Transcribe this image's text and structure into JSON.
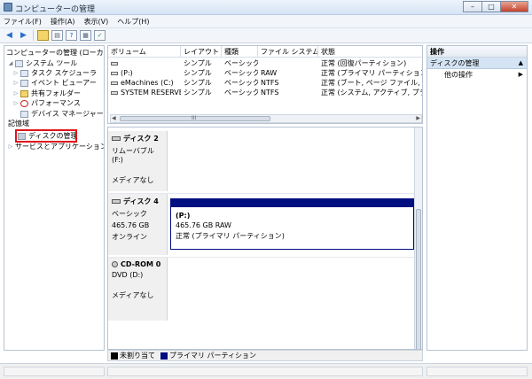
{
  "window": {
    "title": "コンピューターの管理",
    "buttons": [
      "–",
      "□",
      "✕"
    ]
  },
  "menubar": [
    "ファイル(F)",
    "操作(A)",
    "表示(V)",
    "ヘルプ(H)"
  ],
  "toolbar": [
    "back-arrow-icon",
    "forward-arrow-icon",
    "folder-icon",
    "view-icon",
    "help-icon",
    "console-icon",
    "properties-icon"
  ],
  "tree": {
    "root": "コンピューターの管理 (ローカル)",
    "items": [
      {
        "label": "システム ツール",
        "icon": "tools-icon"
      },
      {
        "label": "タスク スケジューラ",
        "icon": "clock-icon"
      },
      {
        "label": "イベント ビューアー",
        "icon": "event-viewer-icon"
      },
      {
        "label": "共有フォルダー",
        "icon": "shared-folder-icon"
      },
      {
        "label": "パフォーマンス",
        "icon": "performance-icon"
      },
      {
        "label": "デバイス マネージャー",
        "icon": "device-manager-icon"
      },
      {
        "label": "記憶域",
        "icon": "storage-icon"
      },
      {
        "label": "ディスクの管理",
        "icon": "disk-icon"
      },
      {
        "label": "サービスとアプリケーション",
        "icon": "services-icon"
      }
    ]
  },
  "volumes": {
    "columns": [
      "ボリューム",
      "レイアウト",
      "種類",
      "ファイル システム",
      "状態"
    ],
    "rows": [
      [
        "",
        "シンプル",
        "ベーシック",
        "",
        "正常 (回復パーティション)"
      ],
      [
        "(P:)",
        "シンプル",
        "ベーシック",
        "RAW",
        "正常 (プライマリ パーティション)"
      ],
      [
        "eMachines (C:)",
        "シンプル",
        "ベーシック",
        "NTFS",
        "正常 (ブート, ページ ファイル, クラ"
      ],
      [
        "SYSTEM RESERVED",
        "シンプル",
        "ベーシック",
        "NTFS",
        "正常 (システム, アクティブ, プライ"
      ]
    ],
    "scroll_center": "III"
  },
  "disks": [
    {
      "name": "ディスク 2",
      "line1": "リムーバブル (F:)",
      "line2": "",
      "line3": "メディアなし"
    },
    {
      "name": "ディスク 4",
      "line1": "ベーシック",
      "line2": "465.76 GB",
      "line3": "オンライン",
      "partition": {
        "label": "(P:)",
        "size": "465.76 GB RAW",
        "status": "正常 (プライマリ パーティション)"
      }
    },
    {
      "name": "CD-ROM 0",
      "line1": "DVD (D:)",
      "line2": "",
      "line3": "メディアなし"
    }
  ],
  "legend": [
    {
      "label": "未割り当て",
      "color": "#000000"
    },
    {
      "label": "プライマリ パーティション",
      "color": "#000e7f"
    }
  ],
  "actions": {
    "header": "操作",
    "section": "ディスクの管理",
    "items": [
      "他の操作"
    ]
  },
  "colors": {
    "accent": "#000e7f",
    "highlight": "#e0161b"
  }
}
